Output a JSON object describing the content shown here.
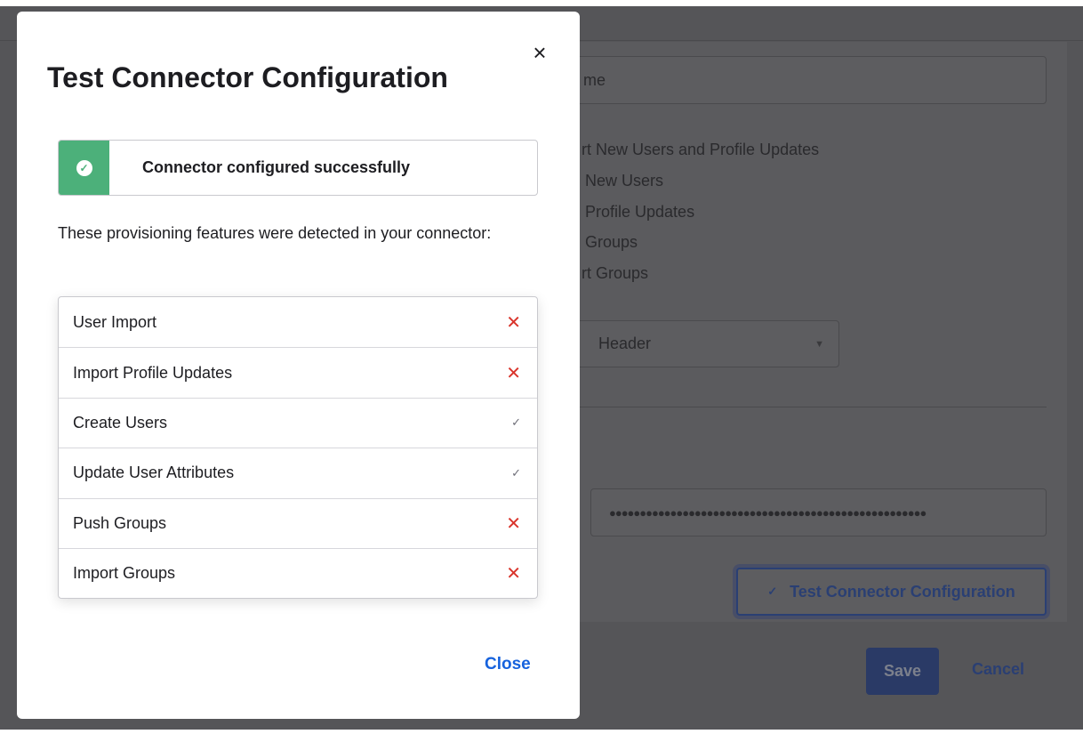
{
  "background": {
    "name_field_value": "me",
    "options": [
      "rt New Users and Profile Updates",
      "New Users",
      "Profile Updates",
      "Groups",
      "rt Groups"
    ],
    "select_value": "Header",
    "password_value": "●●●●●●●●●●●●●●●●●●●●●●●●●●●●●●●●●●●●●●●●●●●●●●●●●●●●",
    "test_button_label": "Test Connector Configuration",
    "save_label": "Save",
    "cancel_label": "Cancel"
  },
  "modal": {
    "title": "Test Connector Configuration",
    "alert": {
      "message": "Connector configured successfully",
      "color": "#4cb07a"
    },
    "description": "These provisioning features were detected in your connector:",
    "features": [
      {
        "label": "User Import",
        "detected": false
      },
      {
        "label": "Import Profile Updates",
        "detected": false
      },
      {
        "label": "Create Users",
        "detected": true
      },
      {
        "label": "Update User Attributes",
        "detected": true
      },
      {
        "label": "Push Groups",
        "detected": false
      },
      {
        "label": "Import Groups",
        "detected": false
      }
    ],
    "close_label": "Close"
  }
}
